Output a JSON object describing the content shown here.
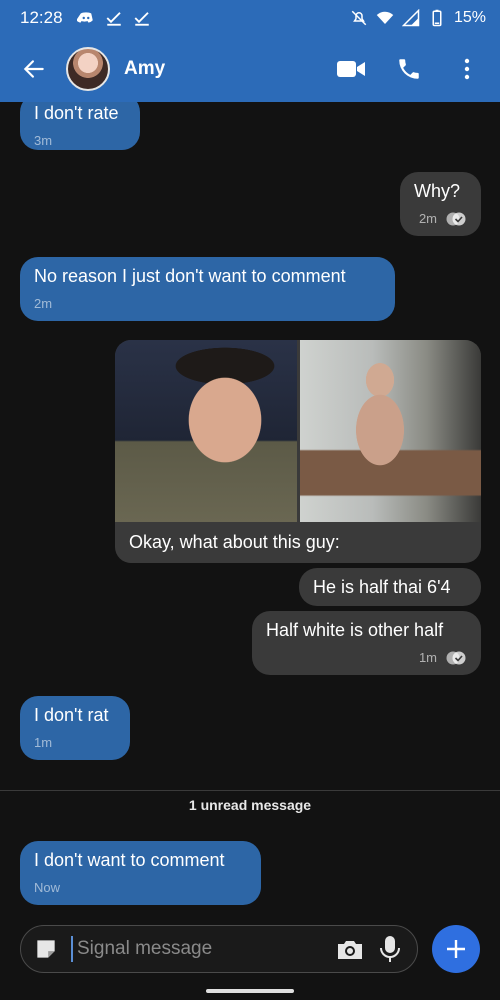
{
  "status_bar": {
    "time": "12:28",
    "battery": "15%",
    "icons": [
      "discord-icon",
      "check-icon",
      "check-icon",
      "mute-icon",
      "wifi-icon",
      "signal-icon",
      "battery-icon"
    ]
  },
  "header": {
    "contact_name": "Amy",
    "icons": [
      "back-arrow-icon",
      "video-call-icon",
      "phone-icon",
      "more-vert-icon"
    ],
    "accent": "#2c6bb8"
  },
  "messages": [
    {
      "id": "m1",
      "direction": "incoming",
      "text": "I don't rate",
      "time": "3m"
    },
    {
      "id": "m2",
      "direction": "outgoing",
      "text": "Why?",
      "time": "2m",
      "delivered": true
    },
    {
      "id": "m3",
      "direction": "incoming",
      "text": "No reason I just don't want to comment",
      "time": "2m"
    },
    {
      "id": "m4",
      "direction": "outgoing",
      "type": "media",
      "caption": "Okay, what about this guy:",
      "photos": 2
    },
    {
      "id": "m5",
      "direction": "outgoing",
      "text": "He is half thai 6'4"
    },
    {
      "id": "m6",
      "direction": "outgoing",
      "text": "Half white is other half",
      "time": "1m",
      "delivered": true
    },
    {
      "id": "m7",
      "direction": "incoming",
      "text": "I don't rat",
      "time": "1m"
    },
    {
      "id": "m8",
      "direction": "incoming",
      "text": "I don't want to comment",
      "time": "Now"
    }
  ],
  "unread_divider": "1 unread message",
  "composer": {
    "placeholder": "Signal message",
    "icons": [
      "sticker-icon",
      "camera-icon",
      "mic-icon",
      "plus-icon"
    ]
  },
  "colors": {
    "incoming_bubble": "#2d66a6",
    "outgoing_bubble": "#3a3a3a",
    "background": "#121212",
    "send_button": "#2f6fe0"
  }
}
